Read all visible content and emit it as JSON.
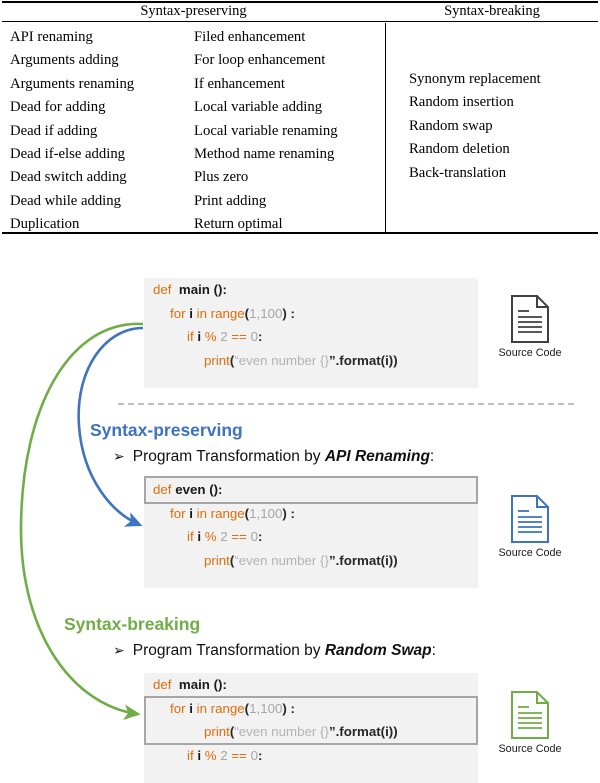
{
  "table": {
    "headers": {
      "preserving": "Syntax-preserving",
      "breaking": "Syntax-breaking"
    },
    "col_a": [
      "API renaming",
      "Arguments adding",
      "Arguments renaming",
      "Dead for adding",
      "Dead if adding",
      "Dead if-else adding",
      "Dead switch adding",
      "Dead while adding",
      "Duplication"
    ],
    "col_b": [
      "Filed enhancement",
      "For loop enhancement",
      "If enhancement",
      "Local variable adding",
      "Local variable renaming",
      "Method name renaming",
      "Plus zero",
      "Print adding",
      "Return optimal"
    ],
    "col_c": [
      "Synonym replacement",
      "Random insertion",
      "Random swap",
      "Random deletion",
      "Back-translation"
    ]
  },
  "diagram": {
    "dashed_divider": true,
    "sections": {
      "preserving": {
        "label": "Syntax-preserving",
        "color": "#3f72bf",
        "bullet": "➢",
        "sub_prefix": "Program Transformation by ",
        "sub_emph": "API Renaming",
        "sub_suffix": ":"
      },
      "breaking": {
        "label": "Syntax-breaking",
        "color": "#70AD47",
        "bullet": "➢",
        "sub_prefix": "Program Transformation by ",
        "sub_emph": "Random Swap",
        "sub_suffix": ":"
      }
    },
    "code_blocks": {
      "original": {
        "lines": [
          {
            "indent": 0,
            "tokens": [
              {
                "t": "def ",
                "c": "kw"
              },
              {
                "t": " main ():",
                "c": "id"
              }
            ]
          },
          {
            "indent": 1,
            "tokens": [
              {
                "t": "for ",
                "c": "kw"
              },
              {
                "t": "i ",
                "c": "id"
              },
              {
                "t": "in range",
                "c": "kw"
              },
              {
                "t": "(",
                "c": "pl"
              },
              {
                "t": "1,100",
                "c": "num"
              },
              {
                "t": ")",
                "c": "pl"
              },
              {
                "t": " :",
                "c": "pl"
              }
            ]
          },
          {
            "indent": 2,
            "tokens": [
              {
                "t": "if ",
                "c": "kw"
              },
              {
                "t": "i ",
                "c": "id"
              },
              {
                "t": "% ",
                "c": "kw"
              },
              {
                "t": "2 ",
                "c": "num"
              },
              {
                "t": "== ",
                "c": "kw"
              },
              {
                "t": "0",
                "c": "num"
              },
              {
                "t": ":",
                "c": "pl"
              }
            ]
          },
          {
            "indent": 3,
            "tokens": [
              {
                "t": "print",
                "c": "kw"
              },
              {
                "t": "(",
                "c": "pl"
              },
              {
                "t": "“even number {}",
                "c": "str"
              },
              {
                "t": "”.format(i))",
                "c": "pl"
              }
            ]
          }
        ]
      },
      "api_renaming": {
        "highlight_line": 0,
        "lines": [
          {
            "indent": 0,
            "tokens": [
              {
                "t": "def ",
                "c": "kw"
              },
              {
                "t": "even ():",
                "c": "id"
              }
            ]
          },
          {
            "indent": 1,
            "tokens": [
              {
                "t": "for ",
                "c": "kw"
              },
              {
                "t": "i ",
                "c": "id"
              },
              {
                "t": "in range",
                "c": "kw"
              },
              {
                "t": "(",
                "c": "pl"
              },
              {
                "t": "1,100",
                "c": "num"
              },
              {
                "t": ")",
                "c": "pl"
              },
              {
                "t": " :",
                "c": "pl"
              }
            ]
          },
          {
            "indent": 2,
            "tokens": [
              {
                "t": "if ",
                "c": "kw"
              },
              {
                "t": "i ",
                "c": "id"
              },
              {
                "t": "% ",
                "c": "kw"
              },
              {
                "t": "2 ",
                "c": "num"
              },
              {
                "t": "== ",
                "c": "kw"
              },
              {
                "t": "0",
                "c": "num"
              },
              {
                "t": ":",
                "c": "pl"
              }
            ]
          },
          {
            "indent": 3,
            "tokens": [
              {
                "t": "print",
                "c": "kw"
              },
              {
                "t": "(",
                "c": "pl"
              },
              {
                "t": "“even number {}",
                "c": "str"
              },
              {
                "t": "”.format(i))",
                "c": "pl"
              }
            ]
          }
        ]
      },
      "random_swap": {
        "highlight_lines": [
          2,
          3
        ],
        "lines": [
          {
            "indent": 0,
            "tokens": [
              {
                "t": "def ",
                "c": "kw"
              },
              {
                "t": " main ():",
                "c": "id"
              }
            ]
          },
          {
            "indent": 1,
            "tokens": [
              {
                "t": "for ",
                "c": "kw"
              },
              {
                "t": "i ",
                "c": "id"
              },
              {
                "t": "in range",
                "c": "kw"
              },
              {
                "t": "(",
                "c": "pl"
              },
              {
                "t": "1,100",
                "c": "num"
              },
              {
                "t": ")",
                "c": "pl"
              },
              {
                "t": " :",
                "c": "pl"
              }
            ]
          },
          {
            "indent": 3,
            "tokens": [
              {
                "t": "print",
                "c": "kw"
              },
              {
                "t": "(",
                "c": "pl"
              },
              {
                "t": "“even number {}",
                "c": "str"
              },
              {
                "t": "”.format(i))",
                "c": "pl"
              }
            ]
          },
          {
            "indent": 2,
            "tokens": [
              {
                "t": "if ",
                "c": "kw"
              },
              {
                "t": "i ",
                "c": "id"
              },
              {
                "t": "% ",
                "c": "kw"
              },
              {
                "t": "2 ",
                "c": "num"
              },
              {
                "t": "== ",
                "c": "kw"
              },
              {
                "t": "0",
                "c": "num"
              },
              {
                "t": ":",
                "c": "pl"
              }
            ]
          }
        ]
      }
    },
    "icons": {
      "source_code_label": "Source Code",
      "icon_colors": {
        "original": "#404040",
        "api_renaming": "#3f72bf",
        "random_swap": "#70AD47"
      }
    },
    "arrows": {
      "blue": {
        "color": "#3f72bf",
        "from": "original-code",
        "to": "api-renaming-code"
      },
      "green": {
        "color": "#70AD47",
        "from": "original-code",
        "to": "random-swap-code"
      }
    }
  }
}
